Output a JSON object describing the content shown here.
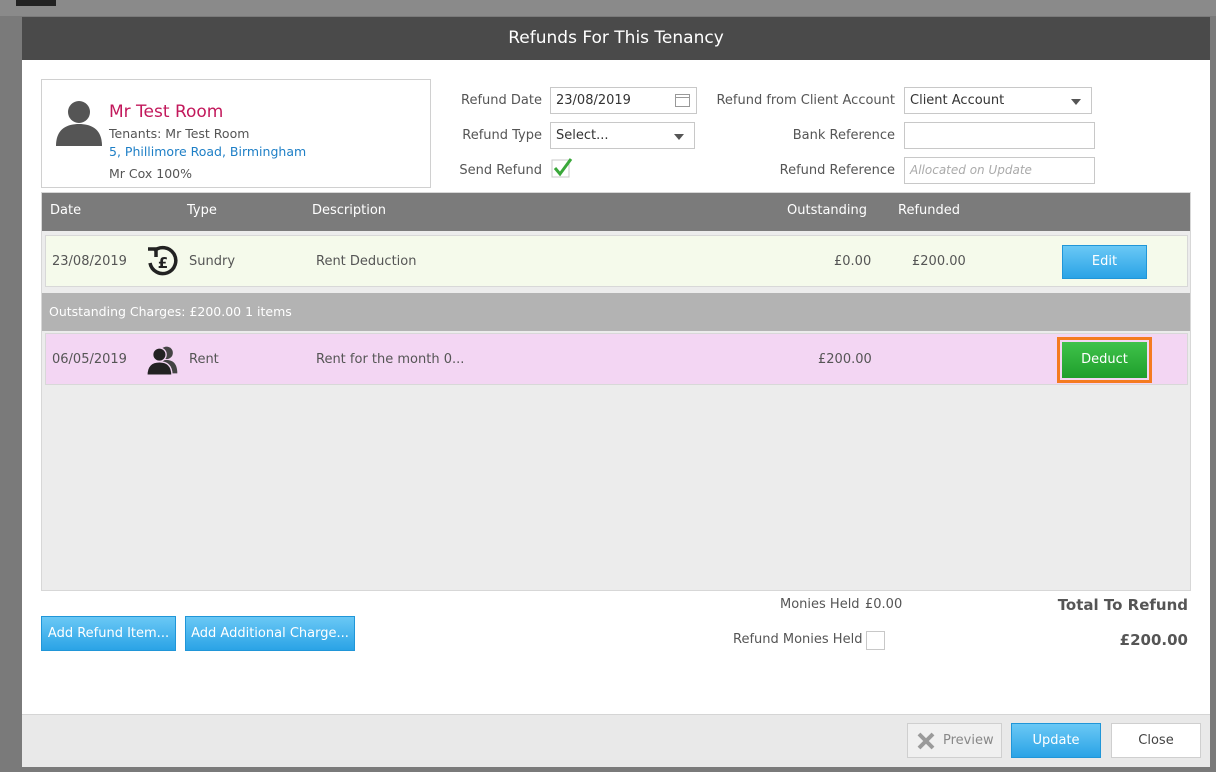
{
  "modal": {
    "title": "Refunds For This Tenancy"
  },
  "tenant": {
    "name": "Mr Test Room",
    "tenants": "Tenants: Mr Test Room",
    "address": "5, Phillimore Road, Birmingham",
    "owner": "Mr Cox 100%"
  },
  "form": {
    "refund_date_label": "Refund Date",
    "refund_date_value": "23/08/2019",
    "refund_type_label": "Refund Type",
    "refund_type_value": "Select...",
    "send_refund_label": "Send Refund",
    "refund_from_label": "Refund from Client Account",
    "refund_from_value": "Client Account",
    "bank_reference_label": "Bank Reference",
    "bank_reference_value": "",
    "refund_reference_label": "Refund Reference",
    "refund_reference_placeholder": "Allocated on Update"
  },
  "grid": {
    "columns": [
      "Date",
      "Type",
      "Description",
      "Outstanding",
      "Refunded"
    ],
    "refund_rows": [
      {
        "date": "23/08/2019",
        "type": "Sundry",
        "description": "Rent Deduction",
        "outstanding": "£0.00",
        "refunded": "£200.00",
        "action": "Edit",
        "icon": "pound-refund-icon"
      }
    ],
    "outstanding_section": "Outstanding Charges: £200.00 1 items",
    "charge_rows": [
      {
        "date": "06/05/2019",
        "type": "Rent",
        "description": "Rent for the month 0...",
        "outstanding": "£200.00",
        "action": "Deduct",
        "icon": "tenants-icon"
      }
    ]
  },
  "actions": {
    "add_refund_item": "Add Refund Item...",
    "add_additional_charge": "Add Additional Charge..."
  },
  "totals": {
    "monies_held_label": "Monies Held",
    "monies_held_value": "£0.00",
    "refund_monies_held_label": "Refund Monies Held",
    "total_to_refund_label": "Total To Refund",
    "total_to_refund_value": "£200.00"
  },
  "footer": {
    "preview": "Preview",
    "update": "Update",
    "close": "Close"
  },
  "colors": {
    "header": "#4a4a4a",
    "accent_blue": "#2aa3e6",
    "deduct_green": "#1f9f2c",
    "highlight_orange": "#f47b20",
    "tenant_name": "#c2185b"
  }
}
